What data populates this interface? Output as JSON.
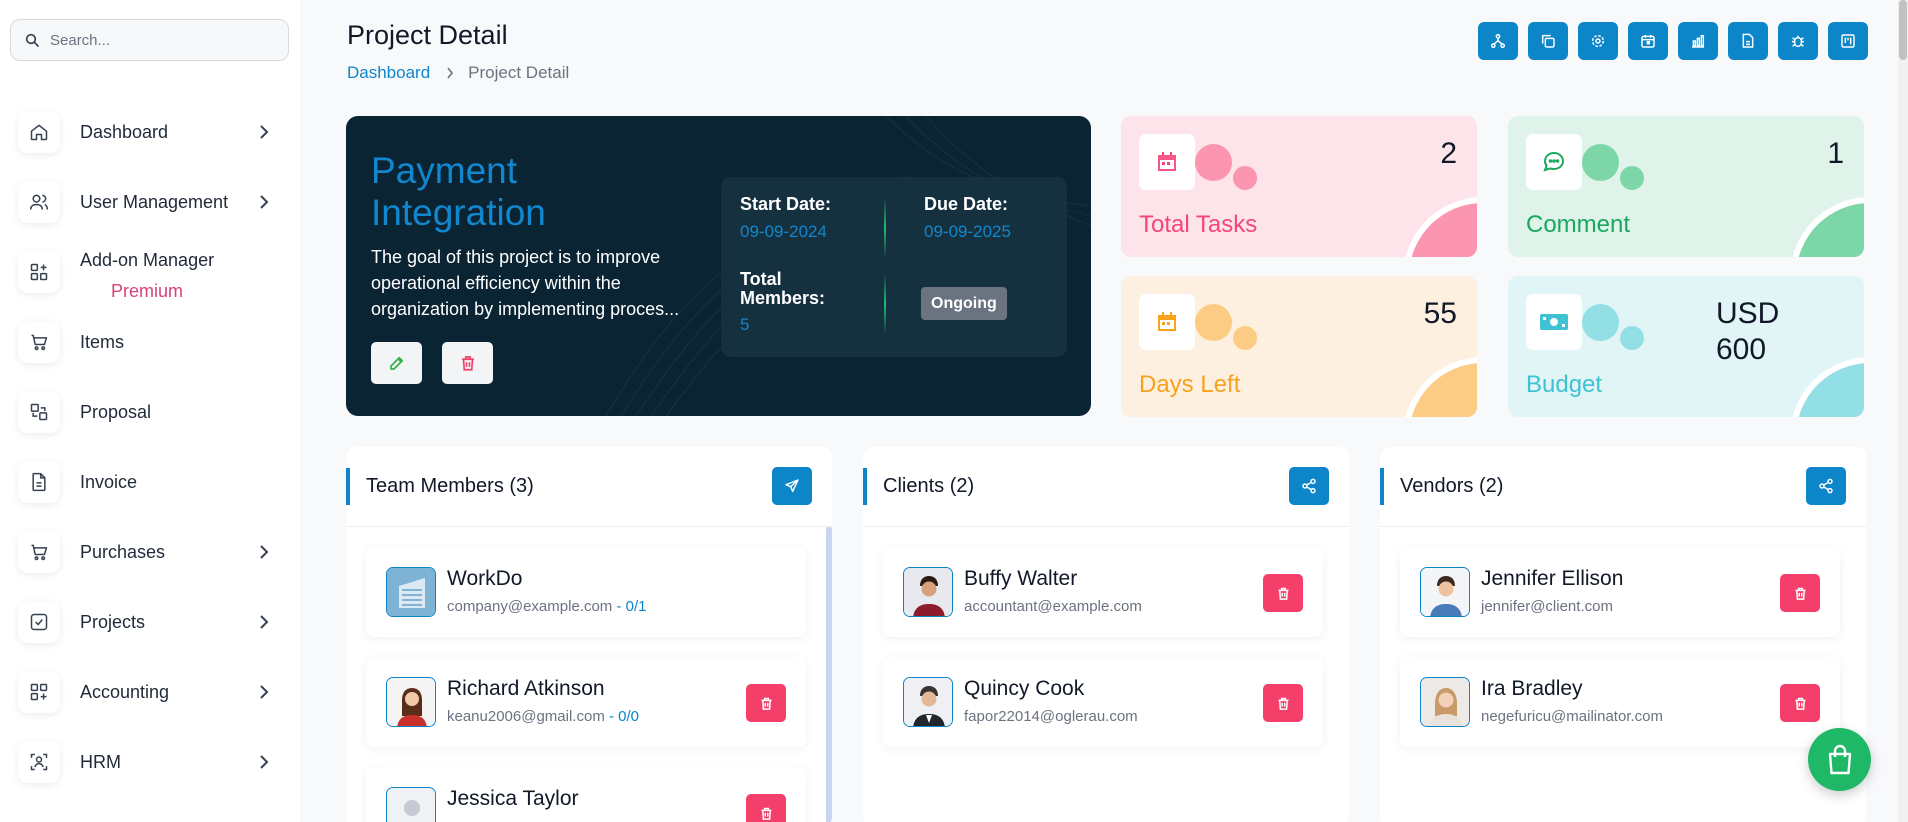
{
  "search": {
    "placeholder": "Search..."
  },
  "sidebar": {
    "items": [
      {
        "label": "Dashboard",
        "icon": "home-icon",
        "has_children": true
      },
      {
        "label": "User Management",
        "icon": "users-icon",
        "has_children": true
      },
      {
        "label": "Add-on Manager",
        "sub_label": "Premium",
        "icon": "addon-icon",
        "has_children": false
      },
      {
        "label": "Items",
        "icon": "cart-icon",
        "has_children": false
      },
      {
        "label": "Proposal",
        "icon": "proposal-icon",
        "has_children": false
      },
      {
        "label": "Invoice",
        "icon": "invoice-icon",
        "has_children": false
      },
      {
        "label": "Purchases",
        "icon": "cart-icon",
        "has_children": true
      },
      {
        "label": "Projects",
        "icon": "check-square-icon",
        "has_children": true
      },
      {
        "label": "Accounting",
        "icon": "accounting-icon",
        "has_children": true
      },
      {
        "label": "HRM",
        "icon": "hrm-icon",
        "has_children": true
      }
    ]
  },
  "header": {
    "title": "Project Detail",
    "breadcrumb": {
      "home": "Dashboard",
      "current": "Project Detail"
    },
    "toolbar_icons": [
      "sitemap-icon",
      "copy-icon",
      "settings-icon",
      "calendar-icon",
      "bar-chart-icon",
      "file-icon",
      "bug-icon",
      "kanban-icon"
    ]
  },
  "project": {
    "title": "Payment Integration",
    "description": "The goal of this project is to improve operational efficiency within the organization by implementing proces...",
    "start_label": "Start Date:",
    "start_date": "09-09-2024",
    "due_label": "Due Date:",
    "due_date": "09-09-2025",
    "members_label": "Total Members:",
    "members_count": "5",
    "status": "Ongoing"
  },
  "stats": {
    "tasks": {
      "value": "2",
      "label": "Total Tasks",
      "color": "#f5457a",
      "bg": "#fce4ea",
      "blob": "#fb95b0"
    },
    "comment": {
      "value": "1",
      "label": "Comment",
      "color": "#18a95f",
      "bg": "#e0f3ea",
      "blob": "#7dd6a8"
    },
    "days": {
      "value": "55",
      "label": "Days Left",
      "color": "#f7a21c",
      "bg": "#fdf0e1",
      "blob": "#fccc85"
    },
    "budget": {
      "value": "USD 600",
      "label": "Budget",
      "color": "#3ec2d4",
      "bg": "#e1f4f6",
      "blob": "#93dfe6"
    }
  },
  "panels": {
    "team": {
      "title": "Team Members (3)",
      "members": [
        {
          "name": "WorkDo",
          "email": "company@example.com",
          "count": " - 0/1"
        },
        {
          "name": "Richard Atkinson",
          "email": "keanu2006@gmail.com",
          "count": " - 0/0"
        },
        {
          "name": "Jessica Taylor",
          "email": "",
          "count": ""
        }
      ]
    },
    "clients": {
      "title": "Clients (2)",
      "members": [
        {
          "name": "Buffy Walter",
          "email": "accountant@example.com"
        },
        {
          "name": "Quincy Cook",
          "email": "fapor22014@oglerau.com"
        }
      ]
    },
    "vendors": {
      "title": "Vendors (2)",
      "members": [
        {
          "name": "Jennifer Ellison",
          "email": "jennifer@client.com"
        },
        {
          "name": "Ira Bradley",
          "email": "negefuricu@mailinator.com"
        }
      ]
    }
  },
  "colors": {
    "accent": "#0c85c9",
    "danger": "#f33f6a",
    "hero_bg": "#0a2434",
    "success": "#1fb866"
  }
}
